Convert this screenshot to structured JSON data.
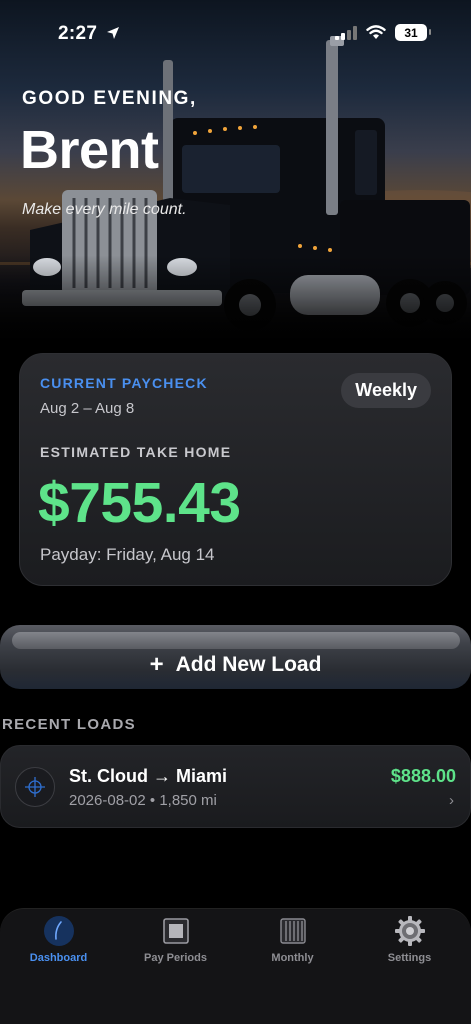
{
  "status_bar": {
    "time": "2:27",
    "battery": "31"
  },
  "header": {
    "greeting": "GOOD EVENING,",
    "name": "Brent",
    "tagline": "Make every mile count."
  },
  "paycheck": {
    "label": "CURRENT PAYCHECK",
    "date_range": "Aug 2 – Aug 8",
    "period": "Weekly",
    "take_home_label": "ESTIMATED TAKE HOME",
    "take_home_amount": "$755.43",
    "payday": "Payday: Friday, Aug 14"
  },
  "add_load": {
    "label": "Add New Load",
    "plus": "+"
  },
  "recent_loads": {
    "title": "RECENT LOADS",
    "items": [
      {
        "route": "St. Cloud → Miami",
        "meta": "2026-08-02 • 1,850 mi",
        "amount": "$888.00",
        "chevron": "›",
        "icon": "crosshair-icon"
      }
    ]
  },
  "tabs": [
    {
      "label": "Dashboard",
      "icon": "dashboard-icon",
      "active": true
    },
    {
      "label": "Pay Periods",
      "icon": "pay-periods-icon",
      "active": false
    },
    {
      "label": "Monthly",
      "icon": "monthly-icon",
      "active": false
    },
    {
      "label": "Settings",
      "icon": "gear-icon",
      "active": false
    }
  ],
  "colors": {
    "accent_blue": "#4a90f0",
    "money_green": "#5ee38a",
    "card_bg": "#1b1c1f",
    "background": "#000000"
  }
}
